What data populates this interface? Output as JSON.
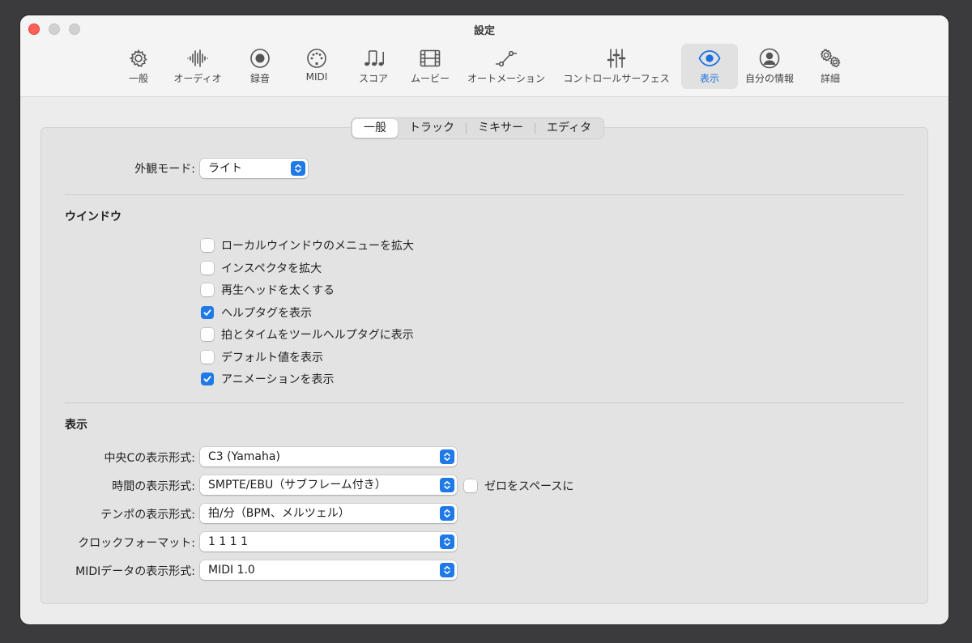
{
  "window": {
    "title": "設定"
  },
  "toolbar": {
    "items": [
      {
        "label": "一般",
        "icon": "gear-icon"
      },
      {
        "label": "オーディオ",
        "icon": "waveform-icon"
      },
      {
        "label": "録音",
        "icon": "record-icon"
      },
      {
        "label": "MIDI",
        "icon": "midi-port-icon"
      },
      {
        "label": "スコア",
        "icon": "notes-icon"
      },
      {
        "label": "ムービー",
        "icon": "film-icon"
      },
      {
        "label": "オートメーション",
        "icon": "automation-curve-icon"
      },
      {
        "label": "コントロールサーフェス",
        "icon": "sliders-icon"
      },
      {
        "label": "表示",
        "icon": "eye-icon",
        "active": true
      },
      {
        "label": "自分の情報",
        "icon": "person-icon"
      },
      {
        "label": "詳細",
        "icon": "gears-icon"
      }
    ]
  },
  "tabs": [
    "一般",
    "トラック",
    "ミキサー",
    "エディタ"
  ],
  "appearance": {
    "label": "外観モード:",
    "value": "ライト"
  },
  "window_section": {
    "title": "ウインドウ",
    "options": [
      {
        "label": "ローカルウインドウのメニューを拡大",
        "checked": false
      },
      {
        "label": "インスペクタを拡大",
        "checked": false
      },
      {
        "label": "再生ヘッドを太くする",
        "checked": false
      },
      {
        "label": "ヘルプタグを表示",
        "checked": true
      },
      {
        "label": "拍とタイムをツールヘルプタグに表示",
        "checked": false
      },
      {
        "label": "デフォルト値を表示",
        "checked": false
      },
      {
        "label": "アニメーションを表示",
        "checked": true
      }
    ]
  },
  "display_section": {
    "title": "表示",
    "rows": [
      {
        "label": "中央Cの表示形式:",
        "value": "C3 (Yamaha)"
      },
      {
        "label": "時間の表示形式:",
        "value": "SMPTE/EBU（サブフレーム付き）"
      },
      {
        "label": "テンポの表示形式:",
        "value": "拍/分（BPM、メルツェル）"
      },
      {
        "label": "クロックフォーマット:",
        "value": "1 1 1 1"
      },
      {
        "label": "MIDIデータの表示形式:",
        "value": "MIDI 1.0"
      }
    ],
    "zero_as_space": {
      "label": "ゼロをスペースに",
      "checked": false
    }
  },
  "colors": {
    "accent": "#1f7ae8",
    "close": "#fe5f57"
  }
}
